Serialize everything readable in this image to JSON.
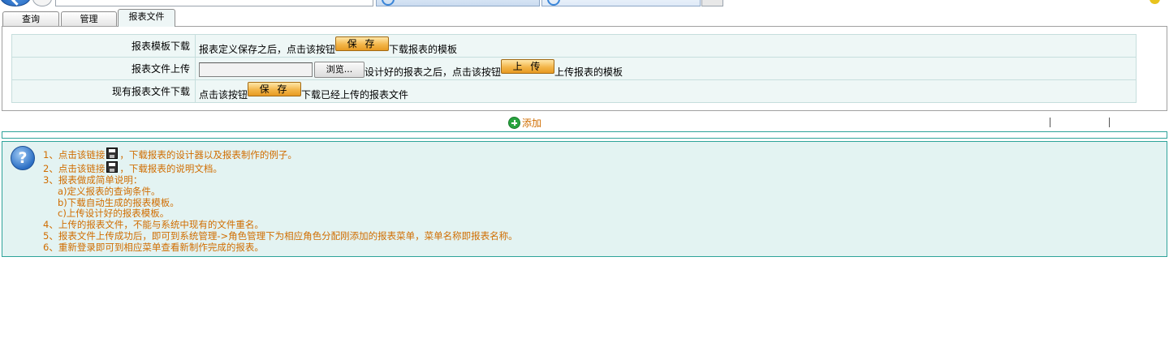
{
  "tabs": {
    "query": "查询",
    "manage": "管理",
    "report_file": "报表文件"
  },
  "form": {
    "row1": {
      "label": "报表模板下载",
      "text_before": "报表定义保存之后，点击该按钮",
      "button": "保 存",
      "text_after": "下载报表的模板"
    },
    "row2": {
      "label": "报表文件上传",
      "browse": "浏览...",
      "text_before": "设计好的报表之后，点击该按钮",
      "button": "上 传",
      "text_after": "上传报表的模板"
    },
    "row3": {
      "label": "现有报表文件下载",
      "text_before": "点击该按钮",
      "button": "保 存",
      "text_after": "下载已经上传的报表文件"
    }
  },
  "add_label": "添加",
  "help": {
    "line1_before": "1、点击该链接",
    "line1_after": "，下载报表的设计器以及报表制作的例子。",
    "line2_before": "2、点击该链接",
    "line2_after": "，下载报表的说明文档。",
    "line3": "3、报表做成简单说明：",
    "line3a": "a)定义报表的查询条件。",
    "line3b": "b)下载自动生成的报表模板。",
    "line3c": "c)上传设计好的报表模板。",
    "line4": "4、上传的报表文件，不能与系统中现有的文件重名。",
    "line5": "5、报表文件上传成功后，即可到系统管理->角色管理下为相应角色分配刚添加的报表菜单，菜单名称即报表名称。",
    "line6": "6、重新登录即可到相应菜单查看新制作完成的报表。"
  },
  "colors": {
    "accent_orange": "#d06d00",
    "help_border": "#2ea39a",
    "help_bg": "#e3f3f2",
    "form_bg": "#eef7f6"
  }
}
